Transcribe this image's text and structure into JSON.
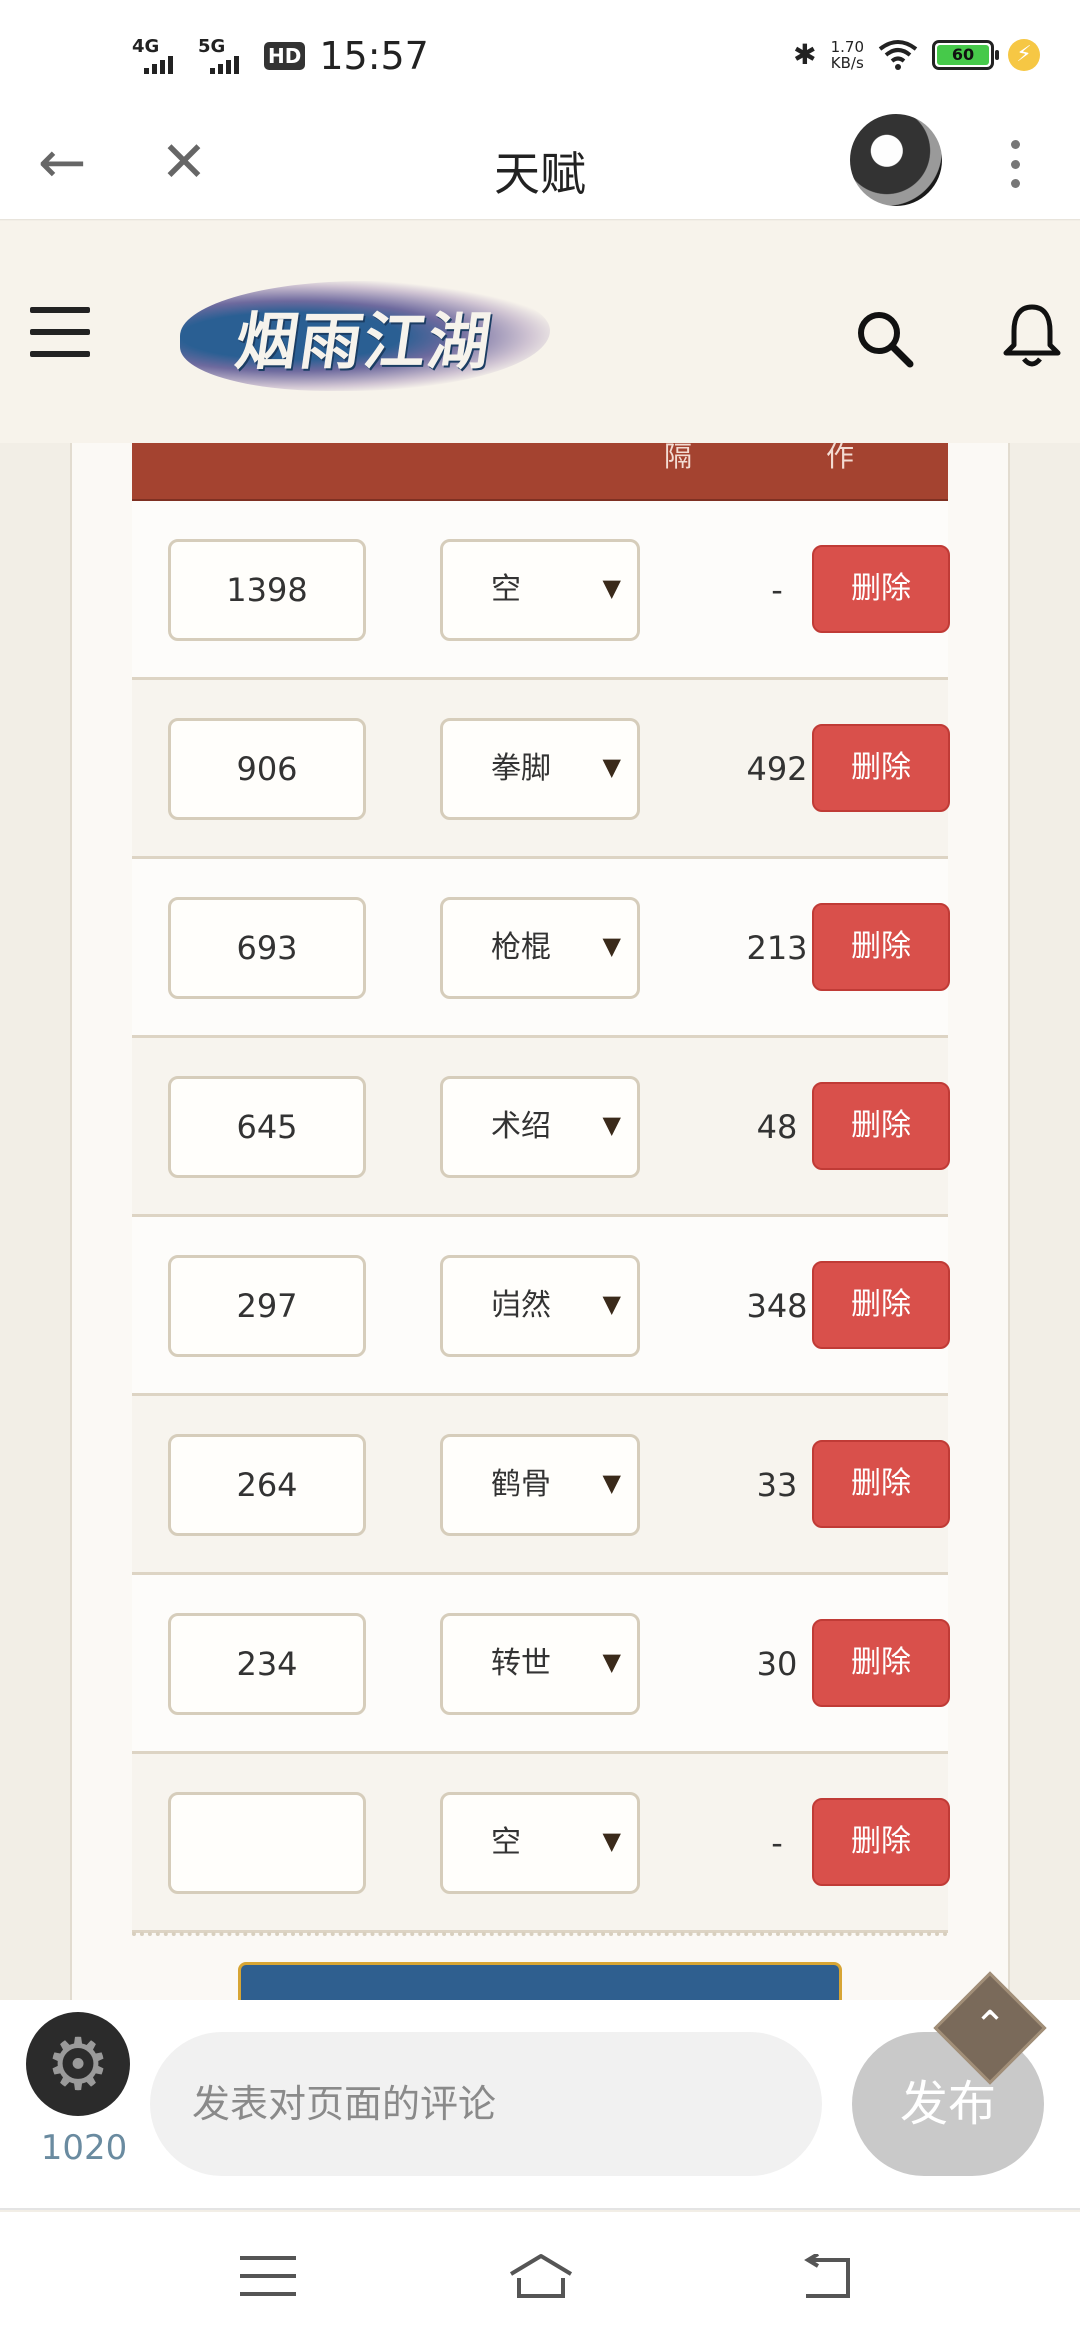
{
  "status_bar": {
    "network1": "4G",
    "network2": "5G",
    "hd": "HD",
    "time": "15:57",
    "speed_value": "1.70",
    "speed_unit": "KB/s",
    "battery": "60"
  },
  "titlebar": {
    "title": "天赋"
  },
  "site": {
    "logo_text": "烟雨江湖"
  },
  "table": {
    "header_partial": [
      "隔",
      "作"
    ],
    "delete_label": "删除",
    "rows": [
      {
        "value": "1398",
        "type": "空",
        "gap": "-"
      },
      {
        "value": "906",
        "type": "拳脚",
        "gap": "492"
      },
      {
        "value": "693",
        "type": "枪棍",
        "gap": "213"
      },
      {
        "value": "645",
        "type": "术绍",
        "gap": "48"
      },
      {
        "value": "297",
        "type": "岿然",
        "gap": "348"
      },
      {
        "value": "264",
        "type": "鹤骨",
        "gap": "33"
      },
      {
        "value": "234",
        "type": "转世",
        "gap": "30"
      },
      {
        "value": "",
        "type": "空",
        "gap": "-"
      }
    ]
  },
  "comment": {
    "placeholder": "发表对页面的评论",
    "publish_label": "发布",
    "counter": "1020"
  },
  "colors": {
    "header_red": "#a44330",
    "delete_red": "#d9504b",
    "logo_blue": "#2a5f93"
  }
}
